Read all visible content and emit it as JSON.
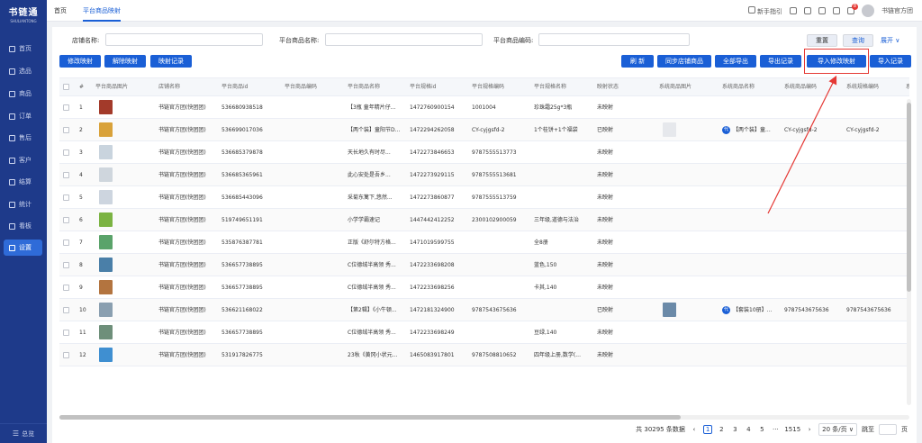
{
  "app": {
    "logo": "书链通",
    "logo_sub": "SHULIANTONG",
    "bottom_label": "总览"
  },
  "sidebar": {
    "items": [
      {
        "label": "首页",
        "icon": "home-icon"
      },
      {
        "label": "选品",
        "icon": "select-icon"
      },
      {
        "label": "商品",
        "icon": "goods-icon"
      },
      {
        "label": "订单",
        "icon": "order-icon"
      },
      {
        "label": "售后",
        "icon": "aftersale-icon"
      },
      {
        "label": "客户",
        "icon": "customer-icon"
      },
      {
        "label": "结算",
        "icon": "settle-icon"
      },
      {
        "label": "统计",
        "icon": "stats-icon"
      },
      {
        "label": "看板",
        "icon": "board-icon"
      },
      {
        "label": "设置",
        "icon": "settings-icon"
      }
    ]
  },
  "topbar": {
    "tabs": [
      "首页",
      "平台商品映射"
    ],
    "guide": "新手指引",
    "notification_count": "8",
    "user": "书链官方团"
  },
  "filters": {
    "shop_label": "店铺名称:",
    "goods_name_label": "平台商品名称:",
    "goods_code_label": "平台商品编码:",
    "reset": "重置",
    "search": "查询",
    "expand": "展开 ∨"
  },
  "toolbar": {
    "left": [
      "修改映射",
      "解除映射",
      "映射记录"
    ],
    "right": [
      "刷 新",
      "同步店铺商品",
      "全部导出",
      "导出记录",
      "导入修改映射",
      "导入记录"
    ]
  },
  "table": {
    "columns": [
      "#",
      "平台商品图片",
      "店铺名称",
      "平台商品id",
      "平台商品编码",
      "平台商品名称",
      "平台规格id",
      "平台规格编码",
      "平台规格名称",
      "映射状态",
      "系统商品图片",
      "系统商品名称",
      "系统商品编码",
      "系统规格编码",
      "系"
    ],
    "rows": [
      {
        "n": "1",
        "shop": "书链官方团(快团团)",
        "gid": "536680938518",
        "gcode": "",
        "gname": "【3瓶 童年精片仔...",
        "sid": "1472760900154",
        "scode": "1001004",
        "sname": "珍珠霜25g*3瓶",
        "status": "未映射",
        "sys_name": "",
        "sys_code": "",
        "sys_scode": "",
        "img": "#a33a2a",
        "sys_img": ""
      },
      {
        "n": "2",
        "shop": "书链官方团(快团团)",
        "gid": "536699017036",
        "gcode": "",
        "gname": "【两个装】童阳节D...",
        "sid": "1472294262058",
        "scode": "CY-cyjgsfd-2",
        "sname": "1个桂饼+1个福袋",
        "status": "已映射",
        "sys_name": "【两个装】童...",
        "sys_code": "CY-cyjgsfd-2",
        "sys_scode": "CY-cyjgsfd-2",
        "img": "#d9a23a",
        "sys_img": "#e6e8ec"
      },
      {
        "n": "3",
        "shop": "书链官方团(快团团)",
        "gid": "536685379878",
        "gcode": "",
        "gname": "天长地久有时尽...",
        "sid": "1472273846653",
        "scode": "9787555513773",
        "sname": "",
        "status": "未映射",
        "sys_name": "",
        "sys_code": "",
        "sys_scode": "",
        "img": "#c9d4de",
        "sys_img": ""
      },
      {
        "n": "4",
        "shop": "书链官方团(快团团)",
        "gid": "536685365961",
        "gcode": "",
        "gname": "此心安处是吾乡...",
        "sid": "1472273929115",
        "scode": "9787555513681",
        "sname": "",
        "status": "未映射",
        "sys_name": "",
        "sys_code": "",
        "sys_scode": "",
        "img": "#cfd6dd",
        "sys_img": ""
      },
      {
        "n": "5",
        "shop": "书链官方团(快团团)",
        "gid": "536685443096",
        "gcode": "",
        "gname": "采菊东篱下,悠然...",
        "sid": "1472273860877",
        "scode": "9787555513759",
        "sname": "",
        "status": "未映射",
        "sys_name": "",
        "sys_code": "",
        "sys_scode": "",
        "img": "#cdd5df",
        "sys_img": ""
      },
      {
        "n": "6",
        "shop": "书链官方团(快团团)",
        "gid": "519749651191",
        "gcode": "",
        "gname": "小学学霸速记",
        "sid": "1447442412252",
        "scode": "2300102900059",
        "sname": "三年级,道德与法治",
        "status": "未映射",
        "sys_name": "",
        "sys_code": "",
        "sys_scode": "",
        "img": "#7bb342",
        "sys_img": ""
      },
      {
        "n": "7",
        "shop": "书链官方团(快团团)",
        "gid": "535876387781",
        "gcode": "",
        "gname": "正版《舒尔特方格...",
        "sid": "1471019599755",
        "scode": "",
        "sname": "全8册",
        "status": "未映射",
        "sys_name": "",
        "sys_code": "",
        "sys_scode": "",
        "img": "#5aa36a",
        "sys_img": ""
      },
      {
        "n": "8",
        "shop": "书链官方团(快团团)",
        "gid": "536657738895",
        "gcode": "",
        "gname": "C位德绒半高领 秀...",
        "sid": "1472233698208",
        "scode": "",
        "sname": "蓝色,150",
        "status": "未映射",
        "sys_name": "",
        "sys_code": "",
        "sys_scode": "",
        "img": "#4a7fa8",
        "sys_img": ""
      },
      {
        "n": "9",
        "shop": "书链官方团(快团团)",
        "gid": "536657738895",
        "gcode": "",
        "gname": "C位德绒半高领 秀...",
        "sid": "1472233698256",
        "scode": "",
        "sname": "卡其,140",
        "status": "未映射",
        "sys_name": "",
        "sys_code": "",
        "sys_scode": "",
        "img": "#b3743f",
        "sys_img": ""
      },
      {
        "n": "10",
        "shop": "书链官方团(快团团)",
        "gid": "536621168022",
        "gcode": "",
        "gname": "【第2辑】《小牛顿...",
        "sid": "1472181324900",
        "scode": "9787543675636",
        "sname": "",
        "status": "已映射",
        "sys_name": "【套装10册】...",
        "sys_code": "9787543675636",
        "sys_scode": "9787543675636",
        "img": "#8a9fb0",
        "sys_img": "#6b8aa8"
      },
      {
        "n": "11",
        "shop": "书链官方团(快团团)",
        "gid": "536657738895",
        "gcode": "",
        "gname": "C位德绒半高领 秀...",
        "sid": "1472233698249",
        "scode": "",
        "sname": "豆绿,140",
        "status": "未映射",
        "sys_name": "",
        "sys_code": "",
        "sys_scode": "",
        "img": "#6e8f7a",
        "sys_img": ""
      },
      {
        "n": "12",
        "shop": "书链官方团(快团团)",
        "gid": "531917826775",
        "gcode": "",
        "gname": "23秋《黄冈小状元...",
        "sid": "1465083917801",
        "scode": "9787508810652",
        "sname": "四年级上册,数学(...",
        "status": "未映射",
        "sys_name": "",
        "sys_code": "",
        "sys_scode": "",
        "img": "#3f8fd1",
        "sys_img": ""
      }
    ]
  },
  "pagination": {
    "total": "共 30295 条数据",
    "pages": [
      "1",
      "2",
      "3",
      "4",
      "5",
      "···",
      "1515"
    ],
    "page_size": "20 条/页 ∨",
    "goto_label": "跳至",
    "page_unit": "页"
  },
  "colors": {
    "primary": "#1a5fd6",
    "sidebar": "#1e3a8a",
    "highlight": "#e53935"
  }
}
